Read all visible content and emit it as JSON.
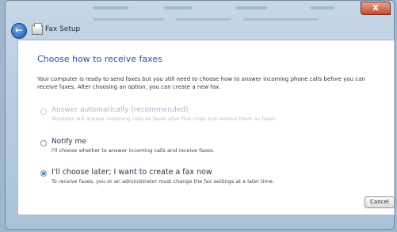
{
  "window": {
    "title": "Fax Setup",
    "close_label": "X"
  },
  "content": {
    "heading": "Choose how to receive faxes",
    "intro": "Your computer is ready to send faxes but you still need to choose how to answer incoming phone calls before you can receive faxes. After choosing an option, you can create a new fax.",
    "options": [
      {
        "title": "Answer automatically (recommended)",
        "desc": "Windows will answer incoming calls as faxes after five rings and receive them as faxes."
      },
      {
        "title": "Notify me",
        "desc": "I'll choose whether to answer incoming calls and receive faxes."
      },
      {
        "title": "I'll choose later; I want to create a fax now",
        "desc": "To receive faxes, you or an administrator must change the fax settings at a later time."
      }
    ]
  },
  "footer": {
    "cancel_label": "Cancel"
  }
}
